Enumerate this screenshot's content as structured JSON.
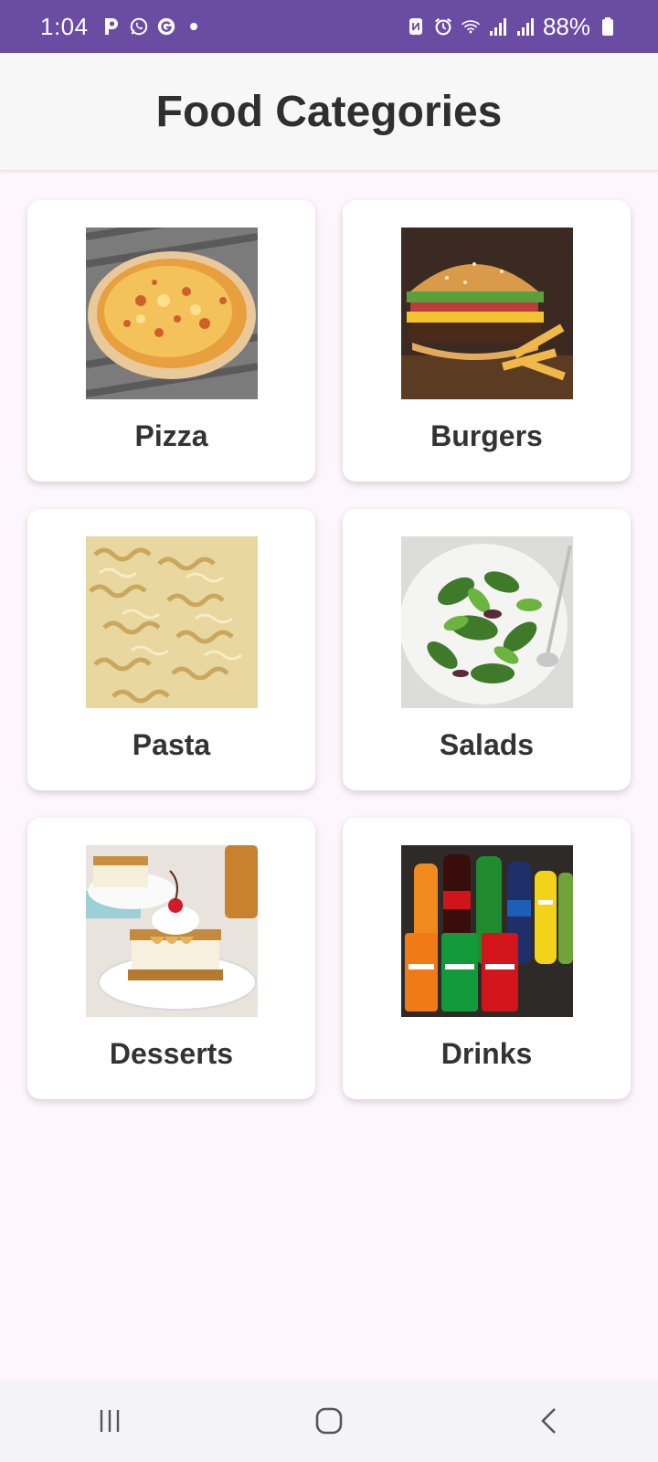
{
  "status_bar": {
    "time": "1:04",
    "battery": "88%",
    "left_icons": [
      "p-icon",
      "whatsapp-icon",
      "g-icon",
      "dot-icon"
    ],
    "right_icons": [
      "nfc-icon",
      "alarm-icon",
      "wifi-icon",
      "signal-icon",
      "signal-icon",
      "battery-icon"
    ]
  },
  "header": {
    "title": "Food Categories"
  },
  "categories": [
    {
      "label": "Pizza",
      "icon": "pizza-image"
    },
    {
      "label": "Burgers",
      "icon": "burger-image"
    },
    {
      "label": "Pasta",
      "icon": "pasta-image"
    },
    {
      "label": "Salads",
      "icon": "salad-image"
    },
    {
      "label": "Desserts",
      "icon": "dessert-image"
    },
    {
      "label": "Drinks",
      "icon": "drinks-image"
    }
  ],
  "nav_bar": {
    "buttons": [
      "recents-icon",
      "home-icon",
      "back-icon"
    ]
  },
  "colors": {
    "status_bar": "#6a4da3",
    "background": "#fdf7fd",
    "header": "#f7f7f7"
  }
}
